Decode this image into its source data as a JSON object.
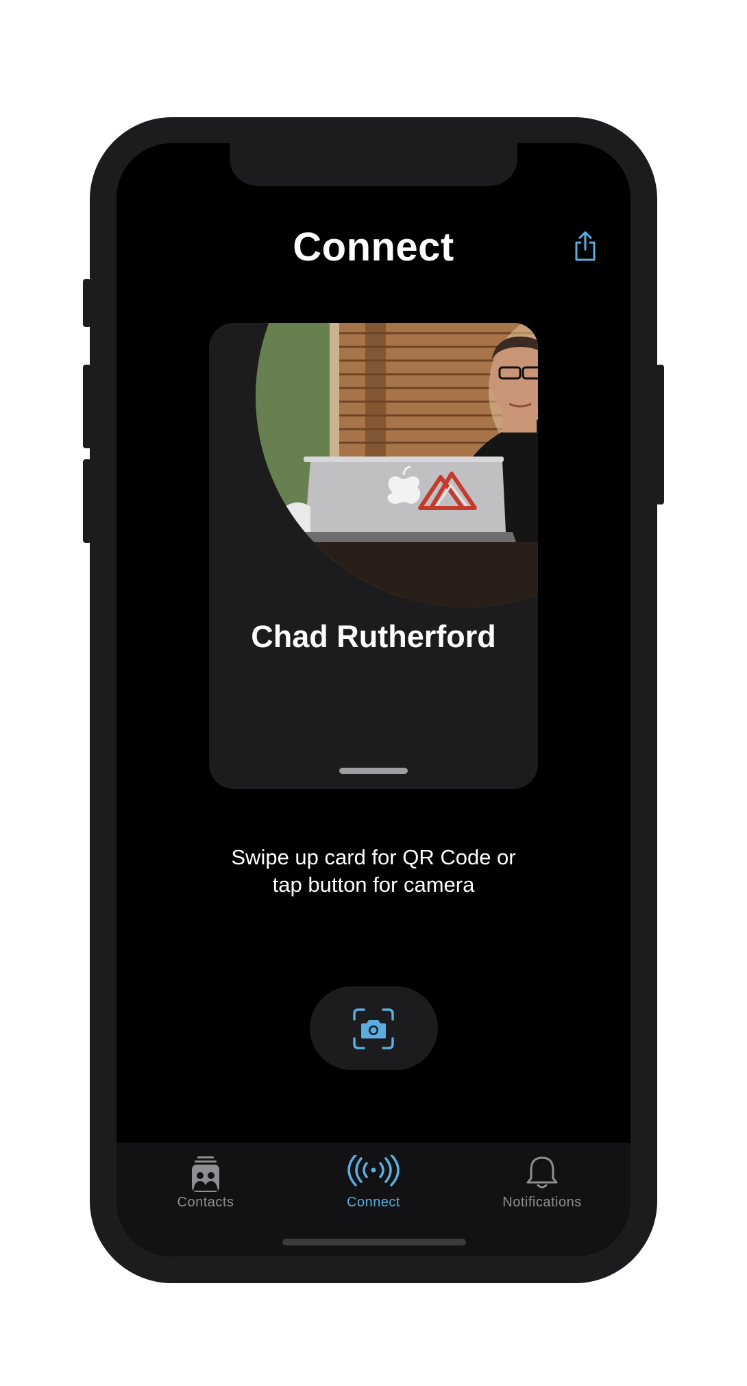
{
  "header": {
    "title": "Connect",
    "share_icon": "share-icon"
  },
  "card": {
    "name": "Chad Rutherford",
    "photo": "profile-photo"
  },
  "hint": {
    "line1": "Swipe up card for QR Code or",
    "line2": "tap button for camera"
  },
  "camera_button": {
    "icon": "camera-scan-icon"
  },
  "tabbar": {
    "tabs": [
      {
        "label": "Contacts",
        "icon": "contacts-icon",
        "selected": false
      },
      {
        "label": "Connect",
        "icon": "connect-broadcast-icon",
        "selected": true
      },
      {
        "label": "Notifications",
        "icon": "bell-icon",
        "selected": false
      }
    ]
  },
  "colors": {
    "accent": "#5aaee0",
    "background": "#000000",
    "card": "#1c1c1e",
    "tab_inactive": "#8e8e93",
    "bezel": "#1c1c1e"
  }
}
